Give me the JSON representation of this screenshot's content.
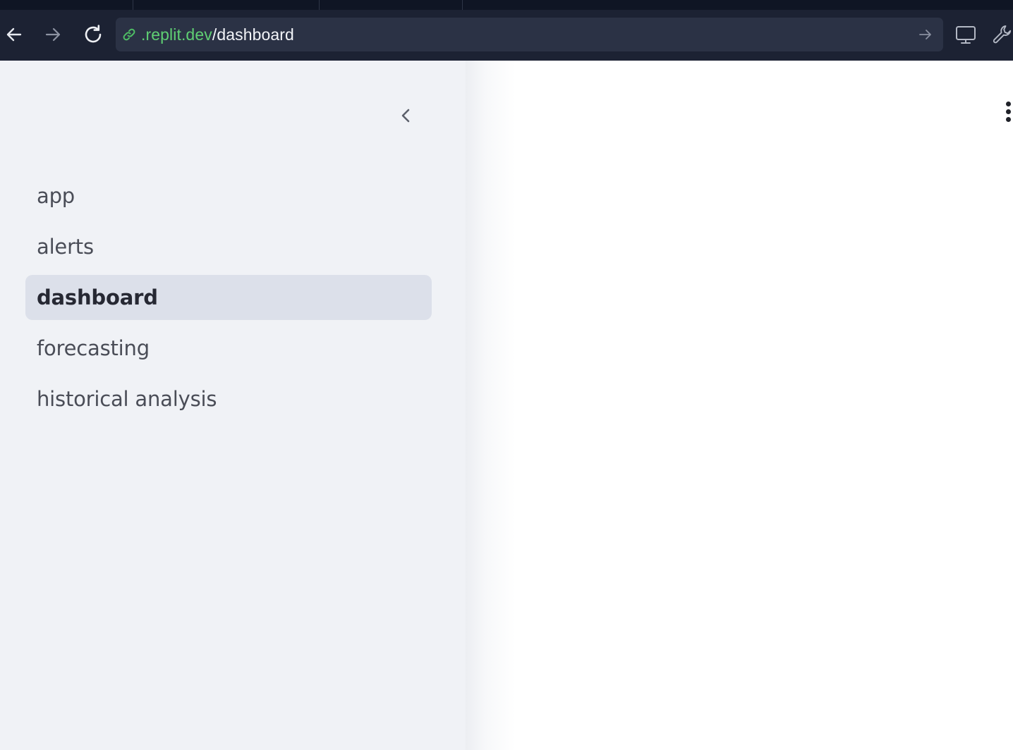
{
  "browser": {
    "url_host": ".replit.dev",
    "url_path": "/dashboard"
  },
  "icons": {
    "back": "arrow-left-icon",
    "forward": "arrow-right-icon",
    "reload": "reload-icon",
    "link": "link-icon",
    "go": "go-arrow-icon",
    "devices": "monitor-icon",
    "devtools": "wrench-icon",
    "collapse": "chevron-left-icon",
    "menu": "kebab-menu-icon"
  },
  "colors": {
    "url_host": "#5fcf73",
    "sidebar_background": "#f0f2f6",
    "active_item_background": "#dce0ea"
  },
  "sidebar": {
    "items": [
      {
        "label": "app",
        "active": false
      },
      {
        "label": "alerts",
        "active": false
      },
      {
        "label": "dashboard",
        "active": true
      },
      {
        "label": "forecasting",
        "active": false
      },
      {
        "label": "historical analysis",
        "active": false
      }
    ]
  }
}
